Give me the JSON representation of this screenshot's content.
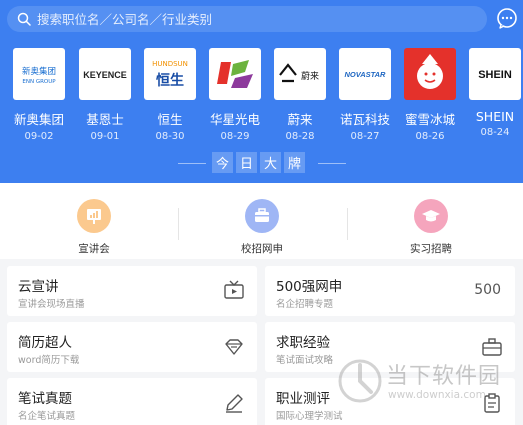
{
  "search": {
    "placeholder": "搜索职位名／公司名／行业类别"
  },
  "companies": [
    {
      "name": "新奥集团",
      "date": "09-02",
      "logo_text": "新奥集团",
      "logo_sub": "ENN GROUP"
    },
    {
      "name": "基恩士",
      "date": "09-01",
      "logo_text": "KEYENCE"
    },
    {
      "name": "恒生",
      "date": "08-30",
      "logo_text": "恒生",
      "logo_sub": "HUNDSUN"
    },
    {
      "name": "华星光电",
      "date": "08-29"
    },
    {
      "name": "蔚来",
      "date": "08-28",
      "logo_text": "蔚来"
    },
    {
      "name": "诺瓦科技",
      "date": "08-27",
      "logo_text": "NOVASTAR"
    },
    {
      "name": "蜜雪冰城",
      "date": "08-26"
    },
    {
      "name": "SHEIN",
      "date": "08-24",
      "logo_text": "SHEIN"
    }
  ],
  "today_chars": [
    "今",
    "日",
    "大",
    "牌"
  ],
  "quick": [
    {
      "label": "宣讲会",
      "color": "#fbc98e",
      "icon": "presentation-icon"
    },
    {
      "label": "校招网申",
      "color": "#9fb6f5",
      "icon": "briefcase-icon"
    },
    {
      "label": "实习招聘",
      "color": "#f5a5bd",
      "icon": "graduation-cap-icon"
    }
  ],
  "cards": [
    {
      "title": "云宣讲",
      "subtitle": "宣讲会现场直播",
      "icon": "tv-icon"
    },
    {
      "title": "500强网申",
      "subtitle": "名企招聘专题",
      "badge": "500"
    },
    {
      "title": "简历超人",
      "subtitle": "word简历下载",
      "icon": "diamond-icon"
    },
    {
      "title": "求职经验",
      "subtitle": "笔试面试攻略",
      "icon": "briefcase-outline-icon"
    },
    {
      "title": "笔试真题",
      "subtitle": "名企笔试真题",
      "icon": "pencil-icon"
    },
    {
      "title": "职业测评",
      "subtitle": "国际心理学测试",
      "icon": "clipboard-icon"
    }
  ],
  "watermark": {
    "title": "当下软件园",
    "url": "www.downxia.com"
  },
  "colors": {
    "primary": "#3d7ff0",
    "page_bg": "#f4f5f7"
  }
}
